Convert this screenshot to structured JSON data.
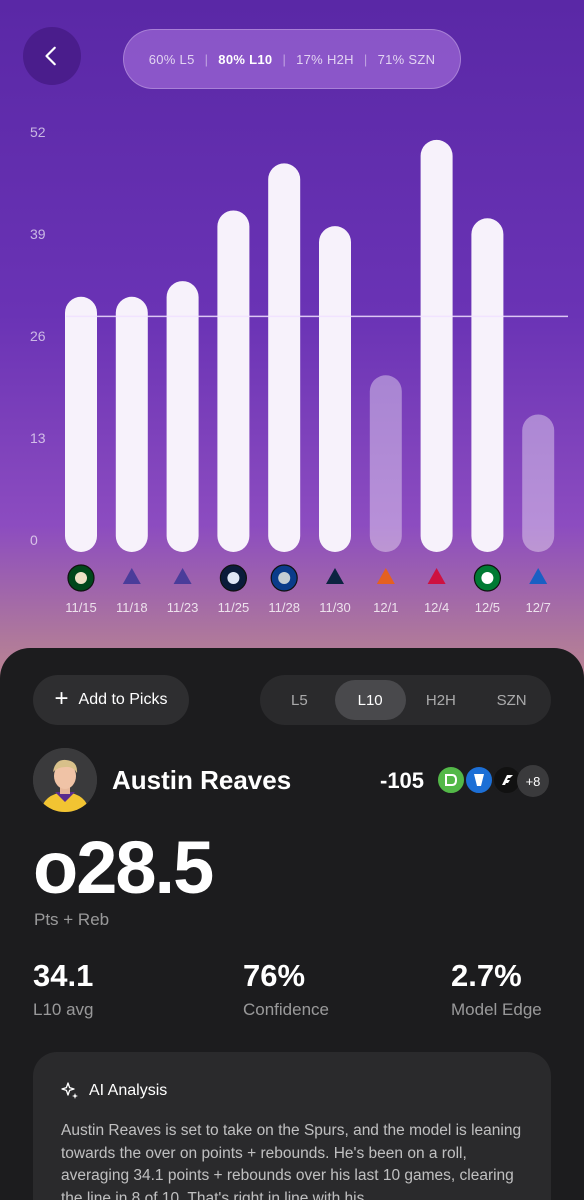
{
  "header": {
    "back_icon": "chevron-left-icon",
    "hit_rates": [
      {
        "label": "60% L5",
        "active": false
      },
      {
        "label": "80% L10",
        "active": true
      },
      {
        "label": "17% H2H",
        "active": false
      },
      {
        "label": "71% SZN",
        "active": false
      }
    ]
  },
  "chart_data": {
    "type": "bar",
    "categories": [
      "11/15",
      "11/18",
      "11/23",
      "11/25",
      "11/28",
      "11/30",
      "12/1",
      "12/4",
      "12/5",
      "12/7"
    ],
    "values": [
      31,
      31,
      33,
      42,
      48,
      40,
      21,
      51,
      41,
      16
    ],
    "hit": [
      true,
      true,
      true,
      true,
      true,
      true,
      false,
      true,
      true,
      false
    ],
    "team_icons": [
      "bucks-icon",
      "jazz-icon",
      "jazz-icon",
      "clippers-icon",
      "mavericks-icon",
      "pelicans-icon",
      "suns-icon",
      "raptors-icon",
      "celtics-icon",
      "76ers-icon"
    ],
    "yticks": [
      0,
      13,
      26,
      39,
      52
    ],
    "ylim": [
      0,
      52
    ],
    "line": 28.5
  },
  "actions": {
    "add_picks_label": "Add to Picks",
    "tabs": [
      {
        "label": "L5",
        "active": false
      },
      {
        "label": "L10",
        "active": true
      },
      {
        "label": "H2H",
        "active": false
      },
      {
        "label": "SZN",
        "active": false
      }
    ]
  },
  "player": {
    "name": "Austin Reaves",
    "odds": "-105",
    "books": [
      {
        "icon": "draftkings-icon",
        "color": "#53b848"
      },
      {
        "icon": "fanduel-icon",
        "color": "#1c6fd6"
      },
      {
        "icon": "fanatics-icon",
        "color": "#111111"
      }
    ],
    "more_books": "+8"
  },
  "prop": {
    "line": "o28.5",
    "market": "Pts + Reb"
  },
  "metrics": [
    {
      "value": "34.1",
      "label": "L10 avg"
    },
    {
      "value": "76%",
      "label": "Confidence"
    },
    {
      "value": "2.7%",
      "label": "Model Edge"
    }
  ],
  "ai": {
    "title": "AI Analysis",
    "text": "Austin Reaves is set to take on the Spurs, and the model is leaning towards the over on points + rebounds. He's been on a roll, averaging 34.1 points + rebounds over his last 10 games, clearing the line in 8 of 10. That's right in line with his"
  }
}
